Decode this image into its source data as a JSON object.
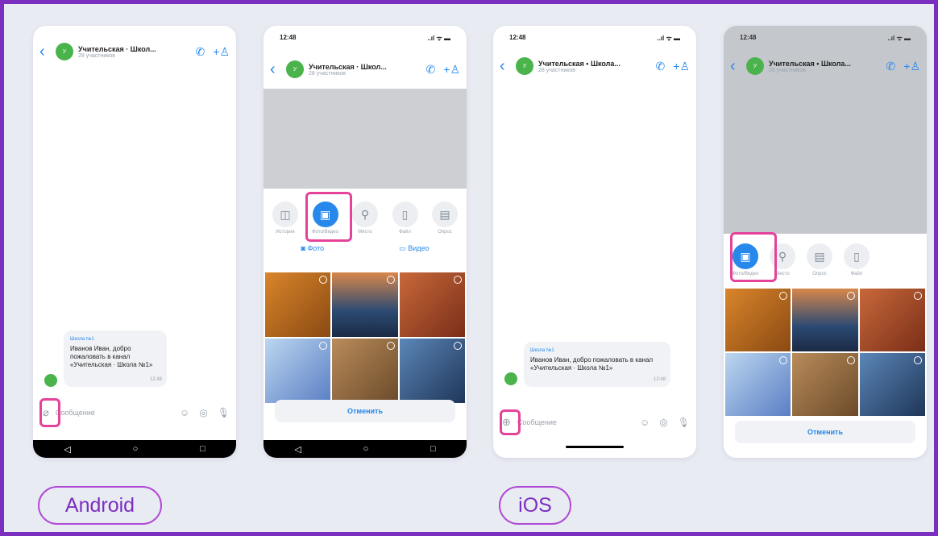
{
  "chat": {
    "title": "Учительская · Школ...",
    "title_ios": "Учительская • Школа...",
    "subtitle": "28 участников",
    "avatar_letter": "У"
  },
  "status": {
    "time": "12:48",
    "indicators": "..ıl ᯤ ▬"
  },
  "message": {
    "from": "Школа №1",
    "text_android": "Иванов Иван, добро пожаловать в канал «Учительская · Школа №1»",
    "text_ios": "Иванов Иван, добро пожаловать в канал «Учительская · Школа №1»",
    "time": "12:48"
  },
  "input": {
    "placeholder": "Сообщение"
  },
  "attach_android": {
    "tabs": [
      "История",
      "Фото/Видео",
      "Место",
      "Файл",
      "Опрос"
    ],
    "photo_label": "Фото",
    "video_label": "Видео",
    "cancel": "Отменить"
  },
  "attach_ios": {
    "tabs": [
      "Фото/Видео",
      "Место",
      "Опрос",
      "Файл"
    ],
    "cancel": "Отменить"
  },
  "labels": {
    "android": "Android",
    "ios": "iOS"
  },
  "icons": {
    "back": "chevron-left-icon",
    "call": "phone-icon",
    "add_user": "add-user-icon",
    "attach": "paperclip-icon",
    "plus": "plus-circle-icon"
  },
  "colors": {
    "accent": "#2688eb",
    "highlight": "#e5429a",
    "frame": "#7b2fbe"
  }
}
